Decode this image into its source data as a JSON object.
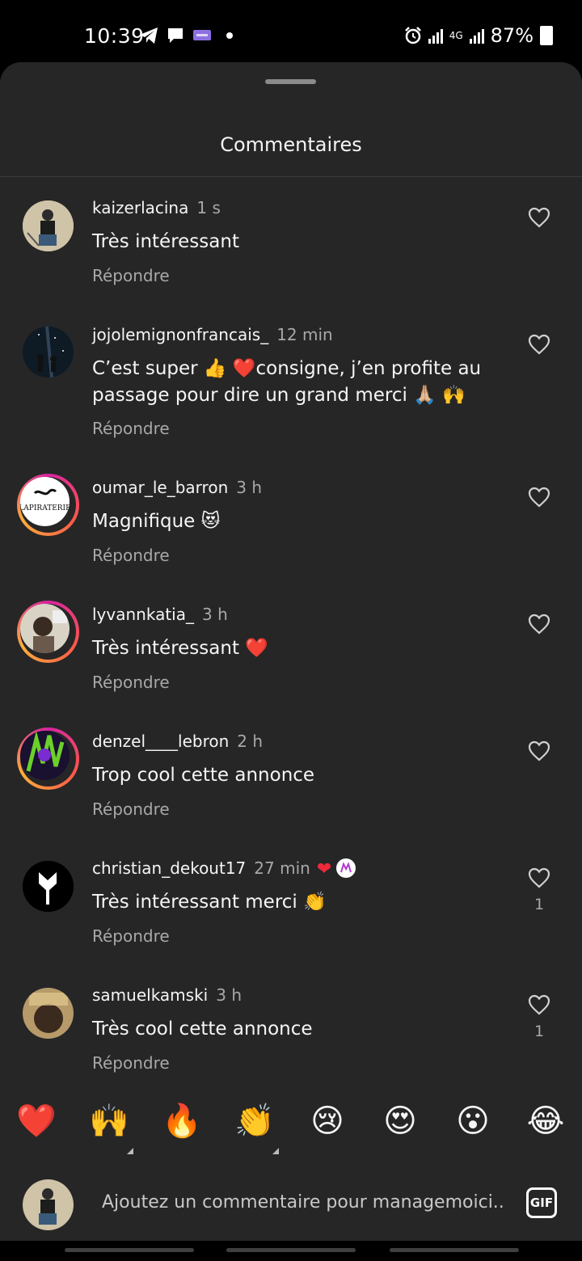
{
  "status_bar": {
    "time": "10:39",
    "network": "4G",
    "battery": "87%",
    "icons": [
      "telegram-icon",
      "message-icon",
      "app-badge-icon",
      "alarm-icon",
      "signal-icon",
      "signal-icon",
      "battery-icon"
    ]
  },
  "sheet": {
    "title": "Commentaires"
  },
  "comments": [
    {
      "user": "kaizerlacina",
      "time": "1 s",
      "text": "Très intéressant",
      "reply": "Répondre",
      "likes": ""
    },
    {
      "user": "jojolemignonfrancais_",
      "time": "12 min",
      "text": "C’est super 👍 ❤️consigne, j’en profite au passage pour dire un grand merci 🙏🏼 🙌",
      "reply": "Répondre",
      "likes": ""
    },
    {
      "user": "oumar_le_barron",
      "time": "3 h",
      "text": "Magnifique 😻",
      "reply": "Répondre",
      "likes": "",
      "avatar_label": "LAPIRATERIE"
    },
    {
      "user": "lyvannkatia_",
      "time": "3 h",
      "text": "Très intéressant ❤️",
      "reply": "Répondre",
      "likes": ""
    },
    {
      "user": "denzel____lebron",
      "time": "2 h",
      "text": "Trop cool cette annonce",
      "reply": "Répondre",
      "likes": ""
    },
    {
      "user": "christian_dekout17",
      "time": "27 min",
      "text": "Très intéressant merci 👏",
      "reply": "Répondre",
      "likes": "1",
      "liked_by_author": true
    },
    {
      "user": "samuelkamski",
      "time": "3 h",
      "text": "Très cool cette annonce",
      "reply": "Répondre",
      "likes": "1"
    }
  ],
  "emoji_bar": [
    "❤️",
    "🙌",
    "🔥",
    "👏",
    "😢",
    "😍",
    "😮",
    "😂"
  ],
  "composer": {
    "placeholder": "Ajoutez un commentaire pour managemoici...",
    "gif_label": "GIF"
  },
  "colors": {
    "background": "#000000",
    "sheet": "#262626",
    "primary_text": "#f5f5f5",
    "secondary_text": "#a8a8a8",
    "heart_red": "#ed2a3a"
  }
}
